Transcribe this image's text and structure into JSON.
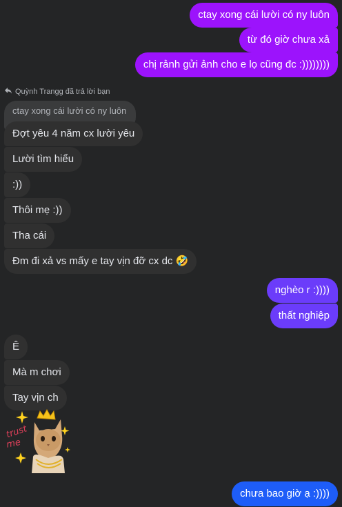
{
  "outgoing_top": [
    "ctay xong cái lười có ny luôn",
    "từ đó giờ chưa xả",
    "chị rảnh gửi ảnh cho e lọ cũng đc :))))))))"
  ],
  "reply": {
    "label": "Quỳnh Trangg đã trả lời bạn",
    "quoted": "ctay xong cái lười có ny luôn",
    "icon": "reply-arrow-icon"
  },
  "incoming_1": [
    "Đợt yêu 4 năm cx lười yêu",
    "Lười tìm hiểu",
    ":))",
    "Thôi mẹ :))",
    "Tha cái",
    "Đm đi xả vs mấy e tay vịn đỡ cx dc 🤣"
  ],
  "outgoing_mid": [
    "nghèo r :))))",
    "thất nghiệp"
  ],
  "incoming_2": [
    "Ê",
    "Mà m chơi",
    "Tay vịn ch"
  ],
  "sticker": {
    "name": "cat-sticker",
    "text": "trust me"
  },
  "outgoing_last": "chưa bao giờ ạ :))))",
  "colors": {
    "background": "#242526",
    "incoming": "#303030",
    "outgoing_purple": "#9c13fc",
    "outgoing_mid": "#6b3cfa",
    "outgoing_blue": "#1e5df8"
  }
}
